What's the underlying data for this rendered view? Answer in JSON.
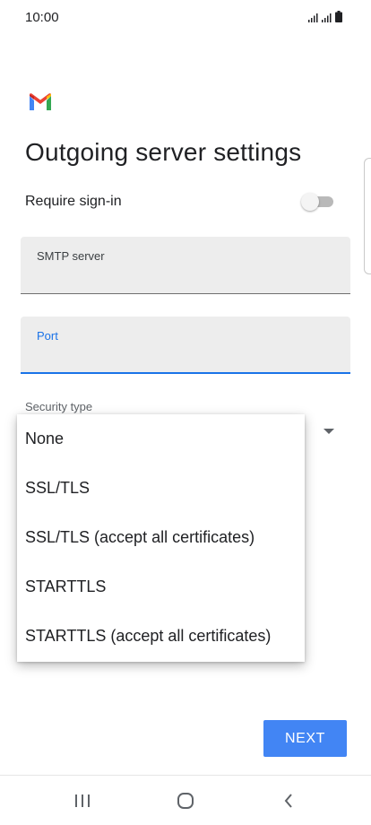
{
  "status_bar": {
    "time": "10:00",
    "icons": [
      "signal-icon",
      "signal-icon",
      "battery-icon"
    ]
  },
  "app": {
    "logo": "gmail-logo-icon"
  },
  "page": {
    "title": "Outgoing server settings"
  },
  "signin": {
    "label": "Require sign-in",
    "enabled": false
  },
  "fields": {
    "smtp": {
      "label": "SMTP server",
      "value": ""
    },
    "port": {
      "label": "Port",
      "value": ""
    }
  },
  "security": {
    "label": "Security type",
    "options": [
      "None",
      "SSL/TLS",
      "SSL/TLS (accept all certificates)",
      "STARTTLS",
      "STARTTLS (accept all certificates)"
    ]
  },
  "actions": {
    "next_label": "NEXT"
  },
  "nav": {
    "recents": "recents-icon",
    "home": "home-icon",
    "back": "back-icon"
  },
  "colors": {
    "accent": "#1a73e8",
    "button": "#4285f4",
    "field_bg": "#ededed"
  }
}
